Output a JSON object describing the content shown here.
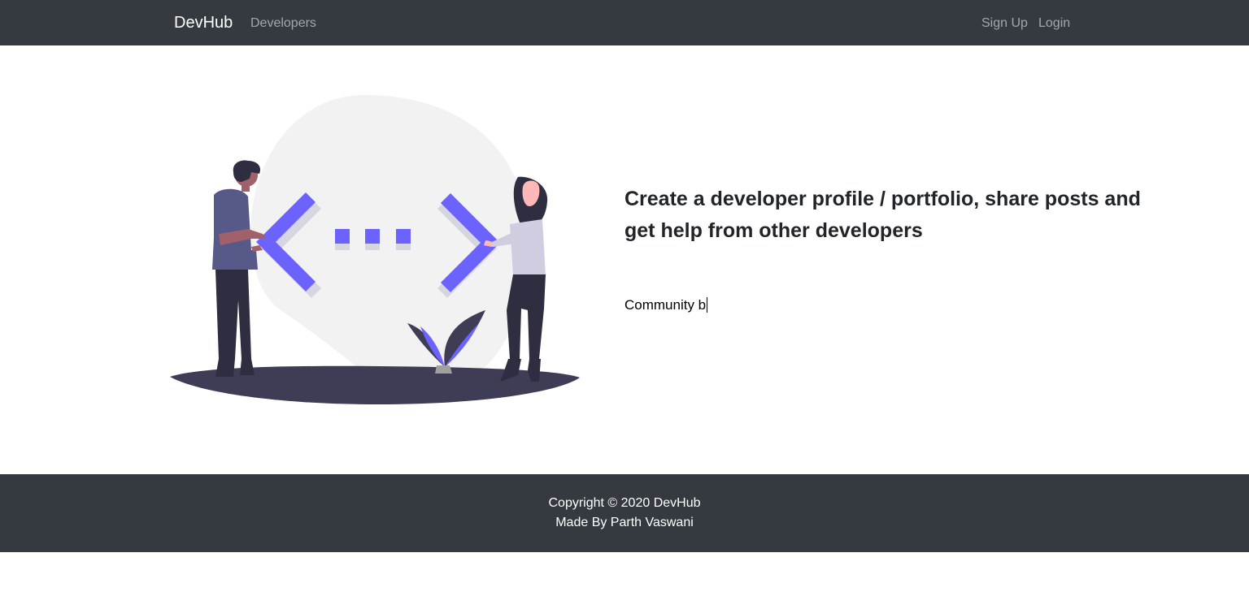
{
  "navbar": {
    "brand": "DevHub",
    "links": {
      "developers": "Developers",
      "signup": "Sign Up",
      "login": "Login"
    }
  },
  "hero": {
    "headline": "Create a developer profile / portfolio, share posts and get help from other developers",
    "typed_text": "Community b",
    "illustration": "two-developers-code-brackets-illustration"
  },
  "footer": {
    "copyright": "Copyright © 2020 DevHub",
    "credit": "Made By Parth Vaswani"
  },
  "colors": {
    "navbar_bg": "#343a40",
    "accent": "#6c63ff",
    "dark_ground": "#3f3d56",
    "blob": "#f2f2f2"
  }
}
